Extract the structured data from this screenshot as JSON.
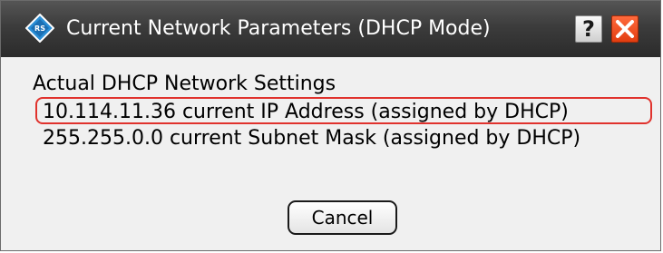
{
  "window": {
    "title": "Current Network Parameters (DHCP Mode)",
    "app_icon": "rohde-schwarz-logo-icon",
    "help_label": "?",
    "close_icon": "close-icon",
    "title_bar_color": "#3c3c3c",
    "close_color": "#e8501e"
  },
  "settings": {
    "heading": "Actual DHCP Network Settings",
    "ip_line": "10.114.11.36 current IP Address (assigned by DHCP)",
    "mask_line": "255.255.0.0 current Subnet Mask (assigned by DHCP)",
    "highlight_color": "#e0322d"
  },
  "buttons": {
    "cancel_label": "Cancel"
  }
}
